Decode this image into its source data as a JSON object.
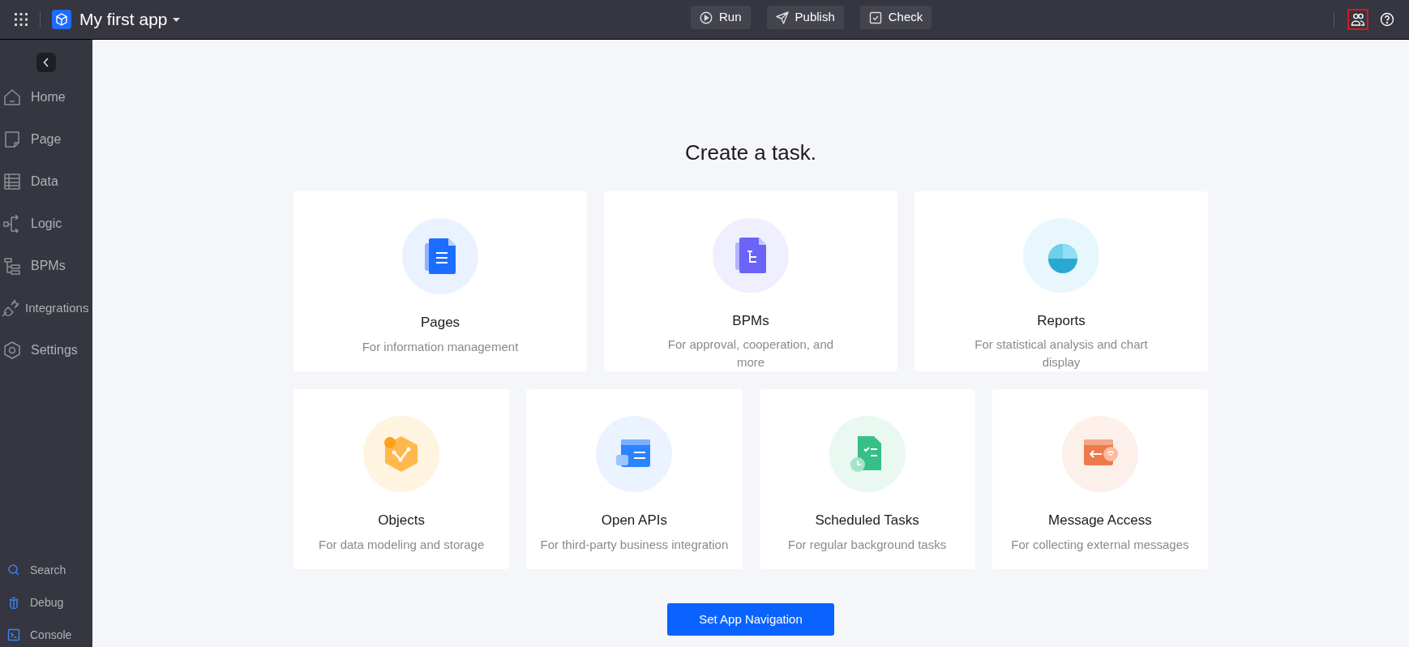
{
  "topbar": {
    "app_name": "My first app",
    "actions": [
      {
        "kind": "run",
        "label": "Run"
      },
      {
        "kind": "publish",
        "label": "Publish"
      },
      {
        "kind": "check",
        "label": "Check"
      }
    ],
    "user_icon_highlighted": true
  },
  "sidebar": {
    "items": [
      {
        "kind": "home",
        "label": "Home"
      },
      {
        "kind": "page",
        "label": "Page"
      },
      {
        "kind": "data",
        "label": "Data"
      },
      {
        "kind": "logic",
        "label": "Logic"
      },
      {
        "kind": "bpms",
        "label": "BPMs"
      },
      {
        "kind": "integrations",
        "label": "Integrations"
      },
      {
        "kind": "settings",
        "label": "Settings"
      }
    ],
    "tools": [
      {
        "kind": "search",
        "label": "Search"
      },
      {
        "kind": "debug",
        "label": "Debug"
      },
      {
        "kind": "console",
        "label": "Console"
      }
    ]
  },
  "main": {
    "title": "Create a task.",
    "cards_row_1": [
      {
        "kind": "pages",
        "title": "Pages",
        "description": "For information management"
      },
      {
        "kind": "bpms",
        "title": "BPMs",
        "description": "For approval, cooperation, and more"
      },
      {
        "kind": "reports",
        "title": "Reports",
        "description": "For statistical analysis and chart display"
      }
    ],
    "cards_row_2": [
      {
        "kind": "objects",
        "title": "Objects",
        "description": "For data modeling and storage"
      },
      {
        "kind": "apis",
        "title": "Open APIs",
        "description": "For third-party business integration"
      },
      {
        "kind": "tasks",
        "title": "Scheduled Tasks",
        "description": "For regular background tasks"
      },
      {
        "kind": "messages",
        "title": "Message Access",
        "description": "For collecting external messages"
      }
    ],
    "button": "Set App Navigation"
  }
}
